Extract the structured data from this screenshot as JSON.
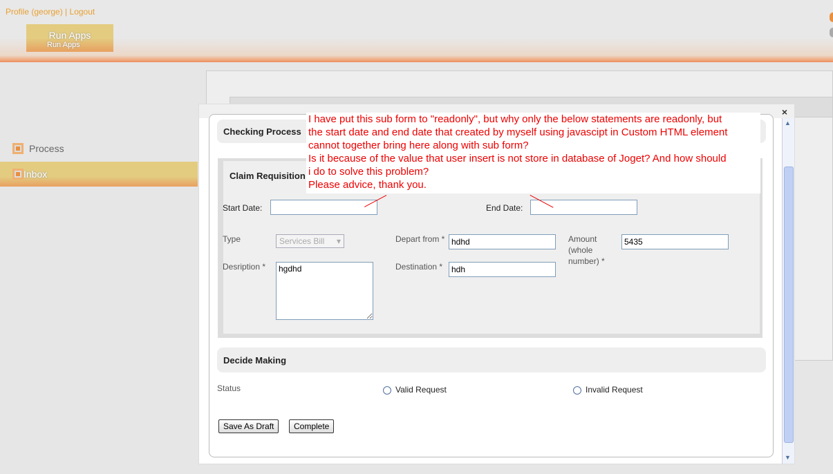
{
  "header": {
    "profile_link": "Profile (george)",
    "separator": " | ",
    "logout_link": "Logout",
    "run_apps_title": "Run Apps",
    "run_apps_subtitle": "Run Apps"
  },
  "sidebar": {
    "items": [
      {
        "label": "Process",
        "icon": "square-bullet-icon"
      },
      {
        "label": "Inbox",
        "icon": "square-bullet-icon",
        "active": true
      }
    ]
  },
  "dialog": {
    "close_label": "×",
    "checking_process": "Checking Process",
    "claim_requisition": "Claim Requisition",
    "start_date_label": "Start Date:",
    "start_date_value": "",
    "end_date_label": "End Date:",
    "end_date_value": "",
    "type_label": "Type",
    "type_value": "Services Bill",
    "depart_label": "Depart from *",
    "depart_value": "hdhd",
    "amount_label": "Amount (whole number) *",
    "amount_value": "5435",
    "description_label": "Desription *",
    "description_value": "hgdhd",
    "destination_label": "Destination *",
    "destination_value": "hdh",
    "decide_making": "Decide Making",
    "status_label": "Status",
    "status_options": [
      "Valid Request",
      "Invalid Request"
    ],
    "save_draft": "Save As Draft",
    "complete": "Complete"
  },
  "annotation": {
    "lines": [
      "I have put this sub form to \"readonly\", but why only the below statements are readonly, but",
      "the start date  and end date that created by myself using javascipt in Custom HTML element",
      "cannot together bring here along with sub form?",
      "Is it because of the value that user insert is not store in database of Joget? And how should",
      "i do to solve this problem?",
      "Please advice, thank you."
    ],
    "color": "#ee0000"
  },
  "colors": {
    "accent": "#e8a030",
    "highlight": "#e3cc80"
  }
}
